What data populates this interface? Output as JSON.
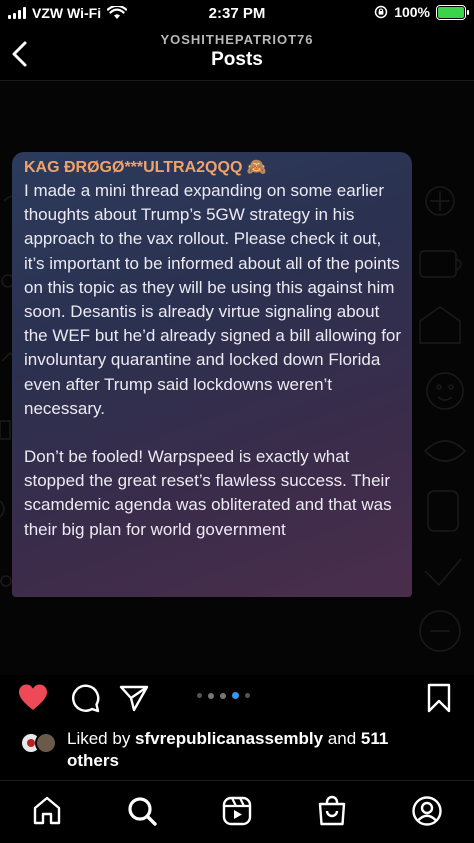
{
  "status_bar": {
    "carrier": "VZW Wi-Fi",
    "time": "2:37 PM",
    "battery": "100%",
    "battery_color": "#3ad34a"
  },
  "header": {
    "username": "YOSHITHEPATRIOT76",
    "title": "Posts",
    "back_icon": "chevron-left-icon"
  },
  "post": {
    "author": "KAG ĐRØGØ***ULTRA2QQQ 🙈",
    "paragraph_1": "I made a mini thread expanding on some earlier thoughts about Trump’s 5GW strategy in his approach to the vax rollout. Please check it out, it’s important to be informed about all of the points on this topic as they will be using this against him soon. Desantis is already virtue signaling about the WEF but he’d already signed a bill allowing for involuntary quarantine and locked down Florida even after Trump said lockdowns weren’t necessary.",
    "paragraph_2": "Don’t be fooled! Warpspeed is exactly what stopped the great reset’s flawless success. Their scamdemic agenda was obliterated and that was their big plan for world government",
    "author_color": "#f0a26b"
  },
  "actions": {
    "like_icon": "heart-filled-icon",
    "like_color": "#ed4956",
    "comment_icon": "comment-icon",
    "share_icon": "send-icon",
    "save_icon": "bookmark-icon",
    "carousel_total": 6,
    "carousel_active": 4,
    "carousel_active_color": "#3897f0"
  },
  "likes": {
    "prefix": "Liked by ",
    "user": "sfvrepublicanassembly",
    "suffix": " and ",
    "count": "511",
    "trailing": "others"
  },
  "bottom_nav": [
    {
      "name": "home-icon"
    },
    {
      "name": "search-icon"
    },
    {
      "name": "reels-icon"
    },
    {
      "name": "shop-icon"
    },
    {
      "name": "profile-icon"
    }
  ]
}
